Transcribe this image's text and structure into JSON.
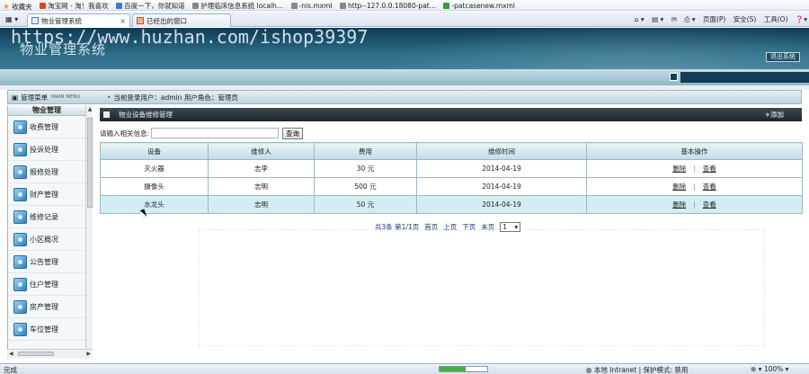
{
  "browser": {
    "favorites": [
      "收藏夹",
      "淘宝网 - 淘！我喜欢",
      "百度一下，你就知道",
      "护理临床信息系统 localh...",
      "-nis.mxml",
      "http--127.0.0.18080-pat...",
      "-patcasenew.mxml"
    ],
    "tabs": [
      {
        "label": "物业管理系统",
        "active": true
      },
      {
        "label": "已经出的窗口",
        "active": false
      }
    ],
    "tools": [
      "页面(P)",
      "安全(S)",
      "工具(O)"
    ],
    "status": "完成",
    "zone": "本地 Intranet | 保护模式: 禁用",
    "zoom": "100%",
    "progress_fraction": 0.55
  },
  "header": {
    "app_title": "物业管理系统",
    "watermark": "https://www.huzhan.com/ishop39397",
    "logout_label": "退出系统"
  },
  "menubar": {
    "menu_label": "管理菜单",
    "menu_sub": "MAIN MENU",
    "user_info": "当前登录用户：admin  用户角色：管理员"
  },
  "sidebar": {
    "title": "物业管理",
    "items": [
      "收费管理",
      "投诉处理",
      "报修处理",
      "财产管理",
      "维修记录",
      "小区概况",
      "公告管理",
      "住户管理",
      "房产管理",
      "车位管理"
    ]
  },
  "main": {
    "panel_title": "物业设备维修管理",
    "add_label": "+添加",
    "search_label": "请输入相关信息:",
    "search_value": "",
    "search_button": "查询",
    "columns": [
      "设备",
      "维修人",
      "费用",
      "维修时间",
      "基本操作"
    ],
    "rows": [
      {
        "device": "灭火器",
        "person": "志李",
        "cost": "30 元",
        "date": "2014-04-19"
      },
      {
        "device": "摄像头",
        "person": "志明",
        "cost": "500 元",
        "date": "2014-04-19"
      },
      {
        "device": "水龙头",
        "person": "志明",
        "cost": "50 元",
        "date": "2014-04-19"
      }
    ],
    "delete_label": "删除",
    "view_label": "查看",
    "pager": {
      "summary": "共3条 第1/1页",
      "first": "首页",
      "prev": "上页",
      "next": "下页",
      "last": "末页",
      "page": "1"
    }
  }
}
